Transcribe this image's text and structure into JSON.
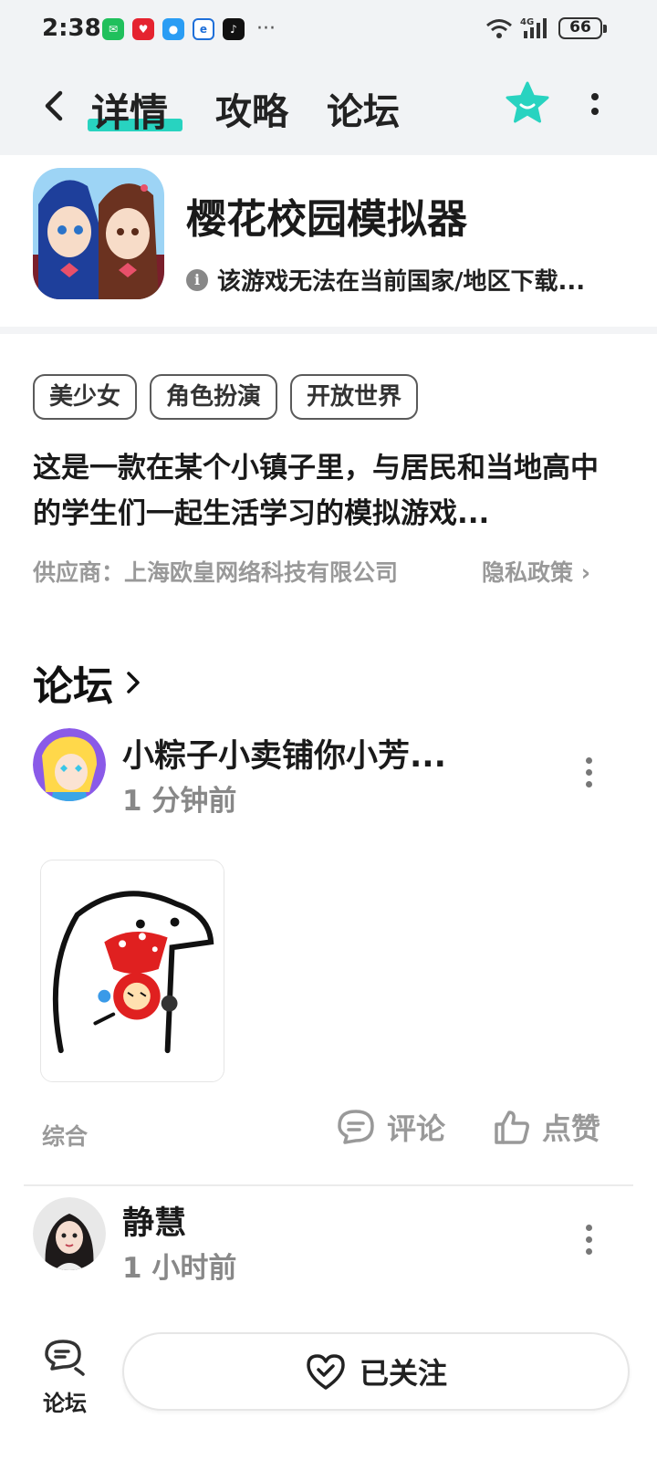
{
  "status_bar": {
    "time": "2:38",
    "apps": [
      "wechat-icon",
      "app-icon",
      "message-icon",
      "browser-icon",
      "tiktok-icon"
    ],
    "more": "···",
    "network": "4G",
    "battery": "66"
  },
  "nav": {
    "tabs": [
      {
        "label": "详情",
        "active": true
      },
      {
        "label": "攻略",
        "active": false
      },
      {
        "label": "论坛",
        "active": false
      }
    ],
    "accent_color": "#28d3c0"
  },
  "game": {
    "title": "樱花校园模拟器",
    "region_notice": "该游戏无法在当前国家/地区下载...",
    "tags": [
      "美少女",
      "角色扮演",
      "开放世界"
    ],
    "description": "这是一款在某个小镇子里，与居民和当地高中的学生们一起生活学习的模拟游戏...",
    "supplier": "供应商：上海欧皇网络科技有限公司",
    "privacy_label": "隐私政策"
  },
  "forum": {
    "heading": "论坛",
    "posts": [
      {
        "author": "小粽子小卖铺你小芳...",
        "time": "1 分钟前",
        "category": "综合",
        "comment_label": "评论",
        "like_label": "点赞"
      },
      {
        "author": "静慧",
        "time": "1 小时前"
      }
    ]
  },
  "bottom_bar": {
    "forum_label": "论坛",
    "follow_label": "已关注"
  }
}
